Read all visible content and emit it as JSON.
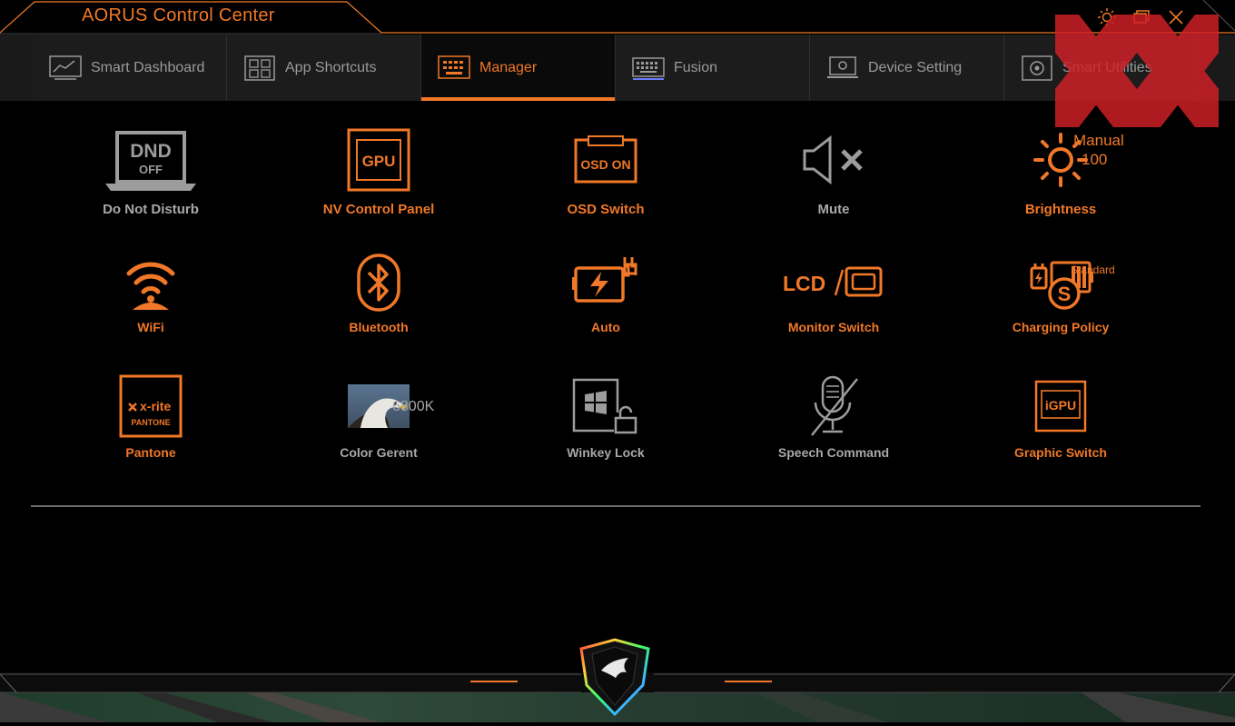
{
  "app": {
    "title": "AORUS Control Center"
  },
  "window_controls": [
    "settings-icon",
    "restore-icon",
    "close-icon"
  ],
  "tabs": [
    {
      "label": "Smart Dashboard",
      "icon": "dashboard-icon",
      "active": false
    },
    {
      "label": "App Shortcuts",
      "icon": "app-shortcuts-icon",
      "active": false
    },
    {
      "label": "Manager",
      "icon": "manager-icon",
      "active": true
    },
    {
      "label": "Fusion",
      "icon": "keyboard-icon",
      "active": false
    },
    {
      "label": "Device Setting",
      "icon": "device-setting-icon",
      "active": false
    },
    {
      "label": "Smart Utilities",
      "icon": "smart-utilities-icon",
      "active": false
    }
  ],
  "manager": {
    "items": [
      {
        "label": "Do Not Disturb",
        "icon": "dnd-laptop-icon",
        "icon_text": [
          "DND",
          "OFF"
        ],
        "state": "off"
      },
      {
        "label": "NV Control Panel",
        "icon": "gpu-icon",
        "icon_text": "GPU",
        "state": "on"
      },
      {
        "label": "OSD Switch",
        "icon": "osd-icon",
        "icon_text": "OSD ON",
        "state": "on"
      },
      {
        "label": "Mute",
        "icon": "speaker-mute-icon",
        "state": "off"
      },
      {
        "label": "Brightness",
        "icon": "sun-icon",
        "state": "on",
        "mode": "Manual",
        "value": "100"
      },
      {
        "label": "WiFi",
        "icon": "wifi-icon",
        "state": "on"
      },
      {
        "label": "Bluetooth",
        "icon": "bluetooth-icon",
        "state": "on"
      },
      {
        "label": "Auto",
        "icon": "battery-charge-icon",
        "state": "on"
      },
      {
        "label": "Monitor Switch",
        "icon": "monitor-switch-icon",
        "icon_text": "LCD",
        "state": "on"
      },
      {
        "label": "Charging Policy",
        "icon": "charging-policy-icon",
        "icon_text": "S",
        "state": "on",
        "mode": "Standard"
      },
      {
        "label": "Pantone",
        "icon": "pantone-icon",
        "icon_text": [
          "x-rite",
          "PANTONE"
        ],
        "state": "on"
      },
      {
        "label": "Color Gerent",
        "icon": "eagle-photo-icon",
        "state": "off",
        "value": "6800K"
      },
      {
        "label": "Winkey Lock",
        "icon": "winkey-lock-icon",
        "state": "off"
      },
      {
        "label": "Speech Command",
        "icon": "mic-off-icon",
        "state": "off"
      },
      {
        "label": "Graphic Switch",
        "icon": "igpu-icon",
        "icon_text": "iGPU",
        "state": "on"
      }
    ]
  },
  "colors": {
    "accent": "#f07828",
    "inactive": "#a8a8a8",
    "background": "#000000",
    "tabbar": "#1c1c1c"
  }
}
